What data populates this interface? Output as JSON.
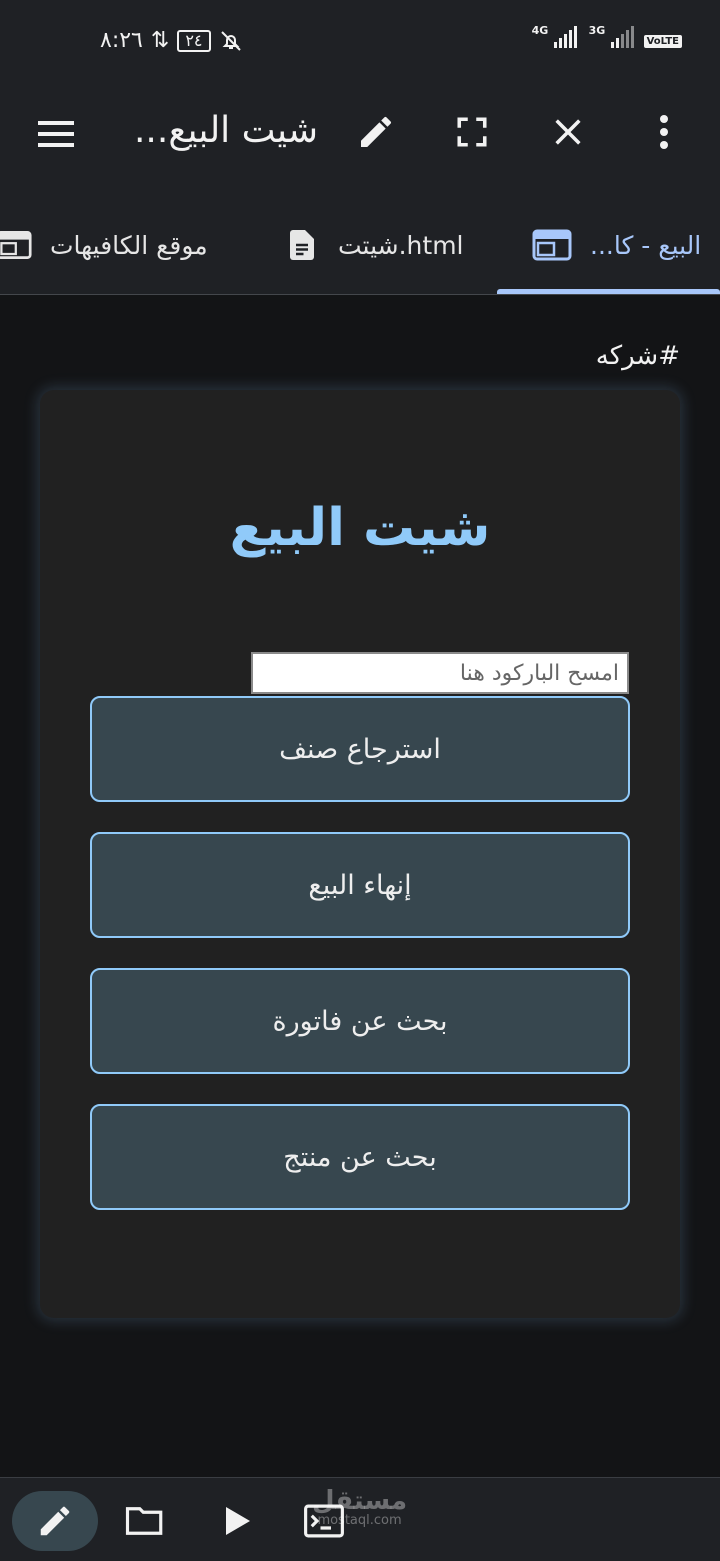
{
  "status_bar": {
    "time": "٨:٢٦",
    "battery": "٢٤",
    "network_1": "4G",
    "network_2": "3G",
    "volte": "VoLTE"
  },
  "app_bar": {
    "title": "شيت البيع...",
    "icons": [
      "menu-icon",
      "edit-icon",
      "fullscreen-icon",
      "close-icon",
      "more-vert-icon"
    ]
  },
  "tabs": [
    {
      "label": "البيع - كا...",
      "icon": "web-layout-icon",
      "active": true
    },
    {
      "label": "شيتت.html",
      "icon": "document-icon",
      "active": false
    },
    {
      "label": "موقع الكافيهات",
      "icon": "web-layout-icon",
      "active": false
    }
  ],
  "content": {
    "hash_text": "#شركه",
    "card_title": "شيت البيع",
    "barcode_placeholder": "امسح الباركود هنا",
    "buttons": [
      "استرجاع صنف",
      "إنهاء البيع",
      "بحث عن فاتورة",
      "بحث عن منتج"
    ]
  },
  "bottom_bar": {
    "icons": [
      "edit-icon",
      "folder-icon",
      "play-icon",
      "terminal-icon"
    ],
    "watermark": "مستقل",
    "watermark_sub": "mostaql.com"
  },
  "colors": {
    "accent": "#90caf9",
    "tab_accent": "#a8c7fa",
    "button_bg": "#37474f",
    "card_bg": "#212121",
    "bar_bg": "#1f2125"
  }
}
